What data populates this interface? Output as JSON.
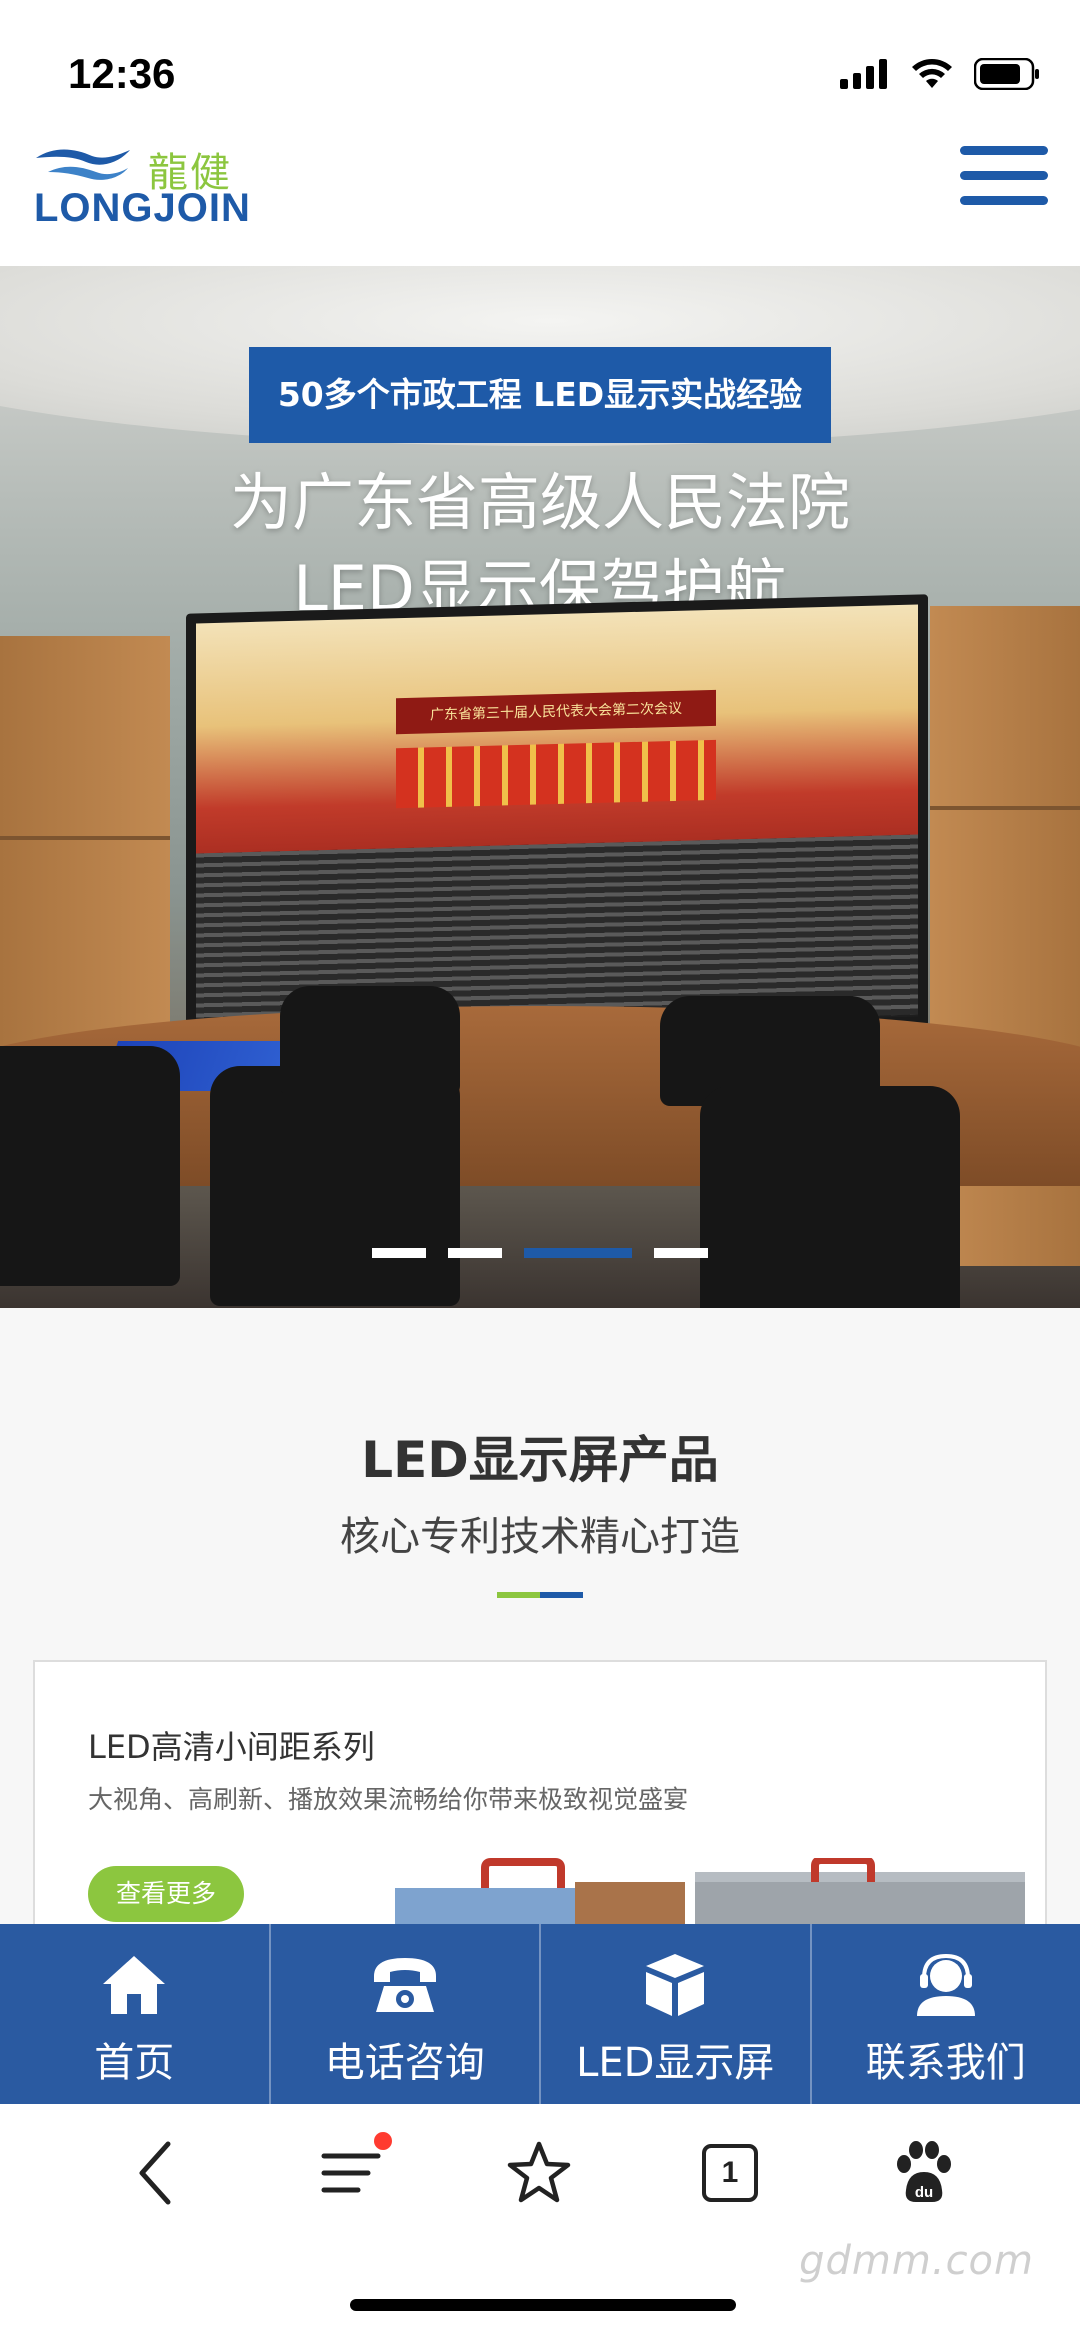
{
  "status_bar": {
    "time": "12:36"
  },
  "logo": {
    "cn": "龍健",
    "en": "LONGJOIN"
  },
  "banner": {
    "badge": "50多个市政工程  LED显示实战经验",
    "title_line1": "为广东省高级人民法院",
    "title_line2": "LED显示保驾护航",
    "screen_text": "广东省第三十届人民代表大会第二次会议",
    "slides_count": 4,
    "active_slide": 3
  },
  "products": {
    "title": "LED显示屏产品",
    "subtitle": "核心专利技术精心打造",
    "card": {
      "title": "LED高清小间距系列",
      "description": "大视角、高刷新、播放效果流畅给你带来极致视觉盛宴",
      "more_label": "查看更多"
    }
  },
  "bottom_nav": {
    "items": [
      {
        "label": "首页",
        "icon": "home-icon"
      },
      {
        "label": "电话咨询",
        "icon": "phone-icon"
      },
      {
        "label": "LED显示屏",
        "icon": "box-icon"
      },
      {
        "label": "联系我们",
        "icon": "support-agent-icon"
      }
    ]
  },
  "browser_toolbar": {
    "icons": [
      "back-icon",
      "menu-icon",
      "star-icon",
      "tabs-icon",
      "baidu-paw-icon"
    ],
    "tab_count": "1"
  },
  "watermark": "gdmm.com",
  "colors": {
    "brand_blue": "#1e5aa8",
    "brand_green": "#8cc63f",
    "nav_blue": "#2a5aa1"
  }
}
